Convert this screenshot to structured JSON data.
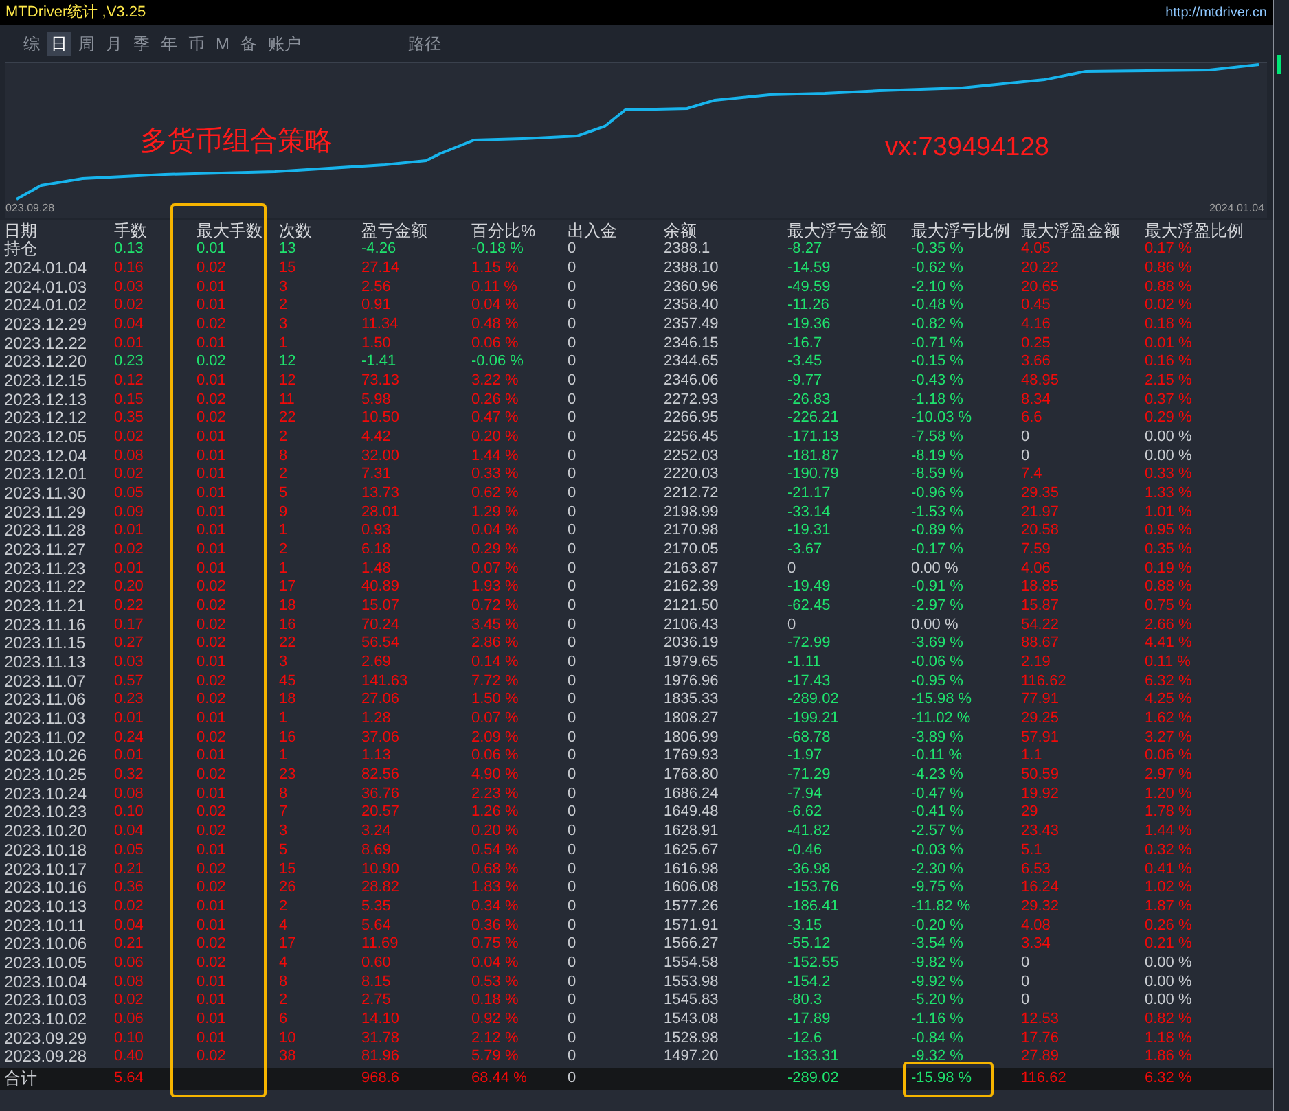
{
  "window": {
    "title": "MTDriver统计 ,V3.25",
    "link": "http://mtdriver.cn"
  },
  "tabs": [
    {
      "label": "综",
      "selected": false
    },
    {
      "label": "日",
      "selected": true
    },
    {
      "label": "周",
      "selected": false
    },
    {
      "label": "月",
      "selected": false
    },
    {
      "label": "季",
      "selected": false
    },
    {
      "label": "年",
      "selected": false
    },
    {
      "label": "币",
      "selected": false
    },
    {
      "label": "M",
      "selected": false
    },
    {
      "label": "备",
      "selected": false
    },
    {
      "label": "账户",
      "selected": false
    },
    {
      "label": "路径",
      "selected": false
    }
  ],
  "equity_chart": {
    "start_label": "023.09.28",
    "end_label": "2024.01.04",
    "caption": "多货币组合策略",
    "contact": "vx:739494128"
  },
  "table": {
    "columns": [
      "日期",
      "手数",
      "最大手数",
      "次数",
      "盈亏金额",
      "百分比%",
      "出入金",
      "余额",
      "最大浮亏金额",
      "最大浮亏比例",
      "最大浮盈金额",
      "最大浮盈比例"
    ],
    "rows": [
      {
        "loss": true,
        "no_float_loss": false,
        "no_float_profit": false,
        "cells": [
          "持仓",
          "0.13",
          "0.01",
          "13",
          "-4.26",
          "-0.18 %",
          "0",
          "2388.1",
          "-8.27",
          "-0.35 %",
          "4.05",
          "0.17 %"
        ]
      },
      {
        "loss": false,
        "no_float_loss": false,
        "no_float_profit": false,
        "cells": [
          "2024.01.04",
          "0.16",
          "0.02",
          "15",
          "27.14",
          "1.15 %",
          "0",
          "2388.10",
          "-14.59",
          "-0.62 %",
          "20.22",
          "0.86 %"
        ]
      },
      {
        "loss": false,
        "no_float_loss": false,
        "no_float_profit": false,
        "cells": [
          "2024.01.03",
          "0.03",
          "0.01",
          "3",
          "2.56",
          "0.11 %",
          "0",
          "2360.96",
          "-49.59",
          "-2.10 %",
          "20.65",
          "0.88 %"
        ]
      },
      {
        "loss": false,
        "no_float_loss": false,
        "no_float_profit": false,
        "cells": [
          "2024.01.02",
          "0.02",
          "0.01",
          "2",
          "0.91",
          "0.04 %",
          "0",
          "2358.40",
          "-11.26",
          "-0.48 %",
          "0.45",
          "0.02 %"
        ]
      },
      {
        "loss": false,
        "no_float_loss": false,
        "no_float_profit": false,
        "cells": [
          "2023.12.29",
          "0.04",
          "0.02",
          "3",
          "11.34",
          "0.48 %",
          "0",
          "2357.49",
          "-19.36",
          "-0.82 %",
          "4.16",
          "0.18 %"
        ]
      },
      {
        "loss": false,
        "no_float_loss": false,
        "no_float_profit": false,
        "cells": [
          "2023.12.22",
          "0.01",
          "0.01",
          "1",
          "1.50",
          "0.06 %",
          "0",
          "2346.15",
          "-16.7",
          "-0.71 %",
          "0.25",
          "0.01 %"
        ]
      },
      {
        "loss": true,
        "no_float_loss": false,
        "no_float_profit": false,
        "cells": [
          "2023.12.20",
          "0.23",
          "0.02",
          "12",
          "-1.41",
          "-0.06 %",
          "0",
          "2344.65",
          "-3.45",
          "-0.15 %",
          "3.66",
          "0.16 %"
        ]
      },
      {
        "loss": false,
        "no_float_loss": false,
        "no_float_profit": false,
        "cells": [
          "2023.12.15",
          "0.12",
          "0.01",
          "12",
          "73.13",
          "3.22 %",
          "0",
          "2346.06",
          "-9.77",
          "-0.43 %",
          "48.95",
          "2.15 %"
        ]
      },
      {
        "loss": false,
        "no_float_loss": false,
        "no_float_profit": false,
        "cells": [
          "2023.12.13",
          "0.15",
          "0.02",
          "11",
          "5.98",
          "0.26 %",
          "0",
          "2272.93",
          "-26.83",
          "-1.18 %",
          "8.34",
          "0.37 %"
        ]
      },
      {
        "loss": false,
        "no_float_loss": false,
        "no_float_profit": false,
        "cells": [
          "2023.12.12",
          "0.35",
          "0.02",
          "22",
          "10.50",
          "0.47 %",
          "0",
          "2266.95",
          "-226.21",
          "-10.03 %",
          "6.6",
          "0.29 %"
        ]
      },
      {
        "loss": false,
        "no_float_loss": false,
        "no_float_profit": true,
        "cells": [
          "2023.12.05",
          "0.02",
          "0.01",
          "2",
          "4.42",
          "0.20 %",
          "0",
          "2256.45",
          "-171.13",
          "-7.58 %",
          "0",
          "0.00 %"
        ]
      },
      {
        "loss": false,
        "no_float_loss": false,
        "no_float_profit": true,
        "cells": [
          "2023.12.04",
          "0.08",
          "0.01",
          "8",
          "32.00",
          "1.44 %",
          "0",
          "2252.03",
          "-181.87",
          "-8.19 %",
          "0",
          "0.00 %"
        ]
      },
      {
        "loss": false,
        "no_float_loss": false,
        "no_float_profit": false,
        "cells": [
          "2023.12.01",
          "0.02",
          "0.01",
          "2",
          "7.31",
          "0.33 %",
          "0",
          "2220.03",
          "-190.79",
          "-8.59 %",
          "7.4",
          "0.33 %"
        ]
      },
      {
        "loss": false,
        "no_float_loss": false,
        "no_float_profit": false,
        "cells": [
          "2023.11.30",
          "0.05",
          "0.01",
          "5",
          "13.73",
          "0.62 %",
          "0",
          "2212.72",
          "-21.17",
          "-0.96 %",
          "29.35",
          "1.33 %"
        ]
      },
      {
        "loss": false,
        "no_float_loss": false,
        "no_float_profit": false,
        "cells": [
          "2023.11.29",
          "0.09",
          "0.01",
          "9",
          "28.01",
          "1.29 %",
          "0",
          "2198.99",
          "-33.14",
          "-1.53 %",
          "21.97",
          "1.01 %"
        ]
      },
      {
        "loss": false,
        "no_float_loss": false,
        "no_float_profit": false,
        "cells": [
          "2023.11.28",
          "0.01",
          "0.01",
          "1",
          "0.93",
          "0.04 %",
          "0",
          "2170.98",
          "-19.31",
          "-0.89 %",
          "20.58",
          "0.95 %"
        ]
      },
      {
        "loss": false,
        "no_float_loss": false,
        "no_float_profit": false,
        "cells": [
          "2023.11.27",
          "0.02",
          "0.01",
          "2",
          "6.18",
          "0.29 %",
          "0",
          "2170.05",
          "-3.67",
          "-0.17 %",
          "7.59",
          "0.35 %"
        ]
      },
      {
        "loss": false,
        "no_float_loss": true,
        "no_float_profit": false,
        "cells": [
          "2023.11.23",
          "0.01",
          "0.01",
          "1",
          "1.48",
          "0.07 %",
          "0",
          "2163.87",
          "0",
          "0.00 %",
          "4.06",
          "0.19 %"
        ]
      },
      {
        "loss": false,
        "no_float_loss": false,
        "no_float_profit": false,
        "cells": [
          "2023.11.22",
          "0.20",
          "0.02",
          "17",
          "40.89",
          "1.93 %",
          "0",
          "2162.39",
          "-19.49",
          "-0.91 %",
          "18.85",
          "0.88 %"
        ]
      },
      {
        "loss": false,
        "no_float_loss": false,
        "no_float_profit": false,
        "cells": [
          "2023.11.21",
          "0.22",
          "0.02",
          "18",
          "15.07",
          "0.72 %",
          "0",
          "2121.50",
          "-62.45",
          "-2.97 %",
          "15.87",
          "0.75 %"
        ]
      },
      {
        "loss": false,
        "no_float_loss": true,
        "no_float_profit": false,
        "cells": [
          "2023.11.16",
          "0.17",
          "0.02",
          "16",
          "70.24",
          "3.45 %",
          "0",
          "2106.43",
          "0",
          "0.00 %",
          "54.22",
          "2.66 %"
        ]
      },
      {
        "loss": false,
        "no_float_loss": false,
        "no_float_profit": false,
        "cells": [
          "2023.11.15",
          "0.27",
          "0.02",
          "22",
          "56.54",
          "2.86 %",
          "0",
          "2036.19",
          "-72.99",
          "-3.69 %",
          "88.67",
          "4.41 %"
        ]
      },
      {
        "loss": false,
        "no_float_loss": false,
        "no_float_profit": false,
        "cells": [
          "2023.11.13",
          "0.03",
          "0.01",
          "3",
          "2.69",
          "0.14 %",
          "0",
          "1979.65",
          "-1.11",
          "-0.06 %",
          "2.19",
          "0.11 %"
        ]
      },
      {
        "loss": false,
        "no_float_loss": false,
        "no_float_profit": false,
        "cells": [
          "2023.11.07",
          "0.57",
          "0.02",
          "45",
          "141.63",
          "7.72 %",
          "0",
          "1976.96",
          "-17.43",
          "-0.95 %",
          "116.62",
          "6.32 %"
        ]
      },
      {
        "loss": false,
        "no_float_loss": false,
        "no_float_profit": false,
        "cells": [
          "2023.11.06",
          "0.23",
          "0.02",
          "18",
          "27.06",
          "1.50 %",
          "0",
          "1835.33",
          "-289.02",
          "-15.98 %",
          "77.91",
          "4.25 %"
        ]
      },
      {
        "loss": false,
        "no_float_loss": false,
        "no_float_profit": false,
        "cells": [
          "2023.11.03",
          "0.01",
          "0.01",
          "1",
          "1.28",
          "0.07 %",
          "0",
          "1808.27",
          "-199.21",
          "-11.02 %",
          "29.25",
          "1.62 %"
        ]
      },
      {
        "loss": false,
        "no_float_loss": false,
        "no_float_profit": false,
        "cells": [
          "2023.11.02",
          "0.24",
          "0.02",
          "16",
          "37.06",
          "2.09 %",
          "0",
          "1806.99",
          "-68.78",
          "-3.89 %",
          "57.91",
          "3.27 %"
        ]
      },
      {
        "loss": false,
        "no_float_loss": false,
        "no_float_profit": false,
        "cells": [
          "2023.10.26",
          "0.01",
          "0.01",
          "1",
          "1.13",
          "0.06 %",
          "0",
          "1769.93",
          "-1.97",
          "-0.11 %",
          "1.1",
          "0.06 %"
        ]
      },
      {
        "loss": false,
        "no_float_loss": false,
        "no_float_profit": false,
        "cells": [
          "2023.10.25",
          "0.32",
          "0.02",
          "23",
          "82.56",
          "4.90 %",
          "0",
          "1768.80",
          "-71.29",
          "-4.23 %",
          "50.59",
          "2.97 %"
        ]
      },
      {
        "loss": false,
        "no_float_loss": false,
        "no_float_profit": false,
        "cells": [
          "2023.10.24",
          "0.08",
          "0.01",
          "8",
          "36.76",
          "2.23 %",
          "0",
          "1686.24",
          "-7.94",
          "-0.47 %",
          "19.92",
          "1.20 %"
        ]
      },
      {
        "loss": false,
        "no_float_loss": false,
        "no_float_profit": false,
        "cells": [
          "2023.10.23",
          "0.10",
          "0.02",
          "7",
          "20.57",
          "1.26 %",
          "0",
          "1649.48",
          "-6.62",
          "-0.41 %",
          "29",
          "1.78 %"
        ]
      },
      {
        "loss": false,
        "no_float_loss": false,
        "no_float_profit": false,
        "cells": [
          "2023.10.20",
          "0.04",
          "0.02",
          "3",
          "3.24",
          "0.20 %",
          "0",
          "1628.91",
          "-41.82",
          "-2.57 %",
          "23.43",
          "1.44 %"
        ]
      },
      {
        "loss": false,
        "no_float_loss": false,
        "no_float_profit": false,
        "cells": [
          "2023.10.18",
          "0.05",
          "0.01",
          "5",
          "8.69",
          "0.54 %",
          "0",
          "1625.67",
          "-0.46",
          "-0.03 %",
          "5.1",
          "0.32 %"
        ]
      },
      {
        "loss": false,
        "no_float_loss": false,
        "no_float_profit": false,
        "cells": [
          "2023.10.17",
          "0.21",
          "0.02",
          "15",
          "10.90",
          "0.68 %",
          "0",
          "1616.98",
          "-36.98",
          "-2.30 %",
          "6.53",
          "0.41 %"
        ]
      },
      {
        "loss": false,
        "no_float_loss": false,
        "no_float_profit": false,
        "cells": [
          "2023.10.16",
          "0.36",
          "0.02",
          "26",
          "28.82",
          "1.83 %",
          "0",
          "1606.08",
          "-153.76",
          "-9.75 %",
          "16.24",
          "1.02 %"
        ]
      },
      {
        "loss": false,
        "no_float_loss": false,
        "no_float_profit": false,
        "cells": [
          "2023.10.13",
          "0.02",
          "0.01",
          "2",
          "5.35",
          "0.34 %",
          "0",
          "1577.26",
          "-186.41",
          "-11.82 %",
          "29.32",
          "1.87 %"
        ]
      },
      {
        "loss": false,
        "no_float_loss": false,
        "no_float_profit": false,
        "cells": [
          "2023.10.11",
          "0.04",
          "0.01",
          "4",
          "5.64",
          "0.36 %",
          "0",
          "1571.91",
          "-3.15",
          "-0.20 %",
          "4.08",
          "0.26 %"
        ]
      },
      {
        "loss": false,
        "no_float_loss": false,
        "no_float_profit": false,
        "cells": [
          "2023.10.06",
          "0.21",
          "0.02",
          "17",
          "11.69",
          "0.75 %",
          "0",
          "1566.27",
          "-55.12",
          "-3.54 %",
          "3.34",
          "0.21 %"
        ]
      },
      {
        "loss": false,
        "no_float_loss": false,
        "no_float_profit": true,
        "cells": [
          "2023.10.05",
          "0.06",
          "0.02",
          "4",
          "0.60",
          "0.04 %",
          "0",
          "1554.58",
          "-152.55",
          "-9.82 %",
          "0",
          "0.00 %"
        ]
      },
      {
        "loss": false,
        "no_float_loss": false,
        "no_float_profit": true,
        "cells": [
          "2023.10.04",
          "0.08",
          "0.01",
          "8",
          "8.15",
          "0.53 %",
          "0",
          "1553.98",
          "-154.2",
          "-9.92 %",
          "0",
          "0.00 %"
        ]
      },
      {
        "loss": false,
        "no_float_loss": false,
        "no_float_profit": true,
        "cells": [
          "2023.10.03",
          "0.02",
          "0.01",
          "2",
          "2.75",
          "0.18 %",
          "0",
          "1545.83",
          "-80.3",
          "-5.20 %",
          "0",
          "0.00 %"
        ]
      },
      {
        "loss": false,
        "no_float_loss": false,
        "no_float_profit": false,
        "cells": [
          "2023.10.02",
          "0.06",
          "0.01",
          "6",
          "14.10",
          "0.92 %",
          "0",
          "1543.08",
          "-17.89",
          "-1.16 %",
          "12.53",
          "0.82 %"
        ]
      },
      {
        "loss": false,
        "no_float_loss": false,
        "no_float_profit": false,
        "cells": [
          "2023.09.29",
          "0.10",
          "0.01",
          "10",
          "31.78",
          "2.12 %",
          "0",
          "1528.98",
          "-12.6",
          "-0.84 %",
          "17.76",
          "1.18 %"
        ]
      },
      {
        "loss": false,
        "no_float_loss": false,
        "no_float_profit": false,
        "cells": [
          "2023.09.28",
          "0.40",
          "0.02",
          "38",
          "81.96",
          "5.79 %",
          "0",
          "1497.20",
          "-133.31",
          "-9.32 %",
          "27.89",
          "1.86 %"
        ]
      }
    ],
    "total": {
      "loss": false,
      "no_float_loss": false,
      "no_float_profit": false,
      "cells": [
        "合计",
        "5.64",
        null,
        null,
        "968.6",
        "68.44 %",
        "0",
        null,
        "-289.02",
        "-15.98 %",
        "116.62",
        "6.32 %"
      ]
    }
  }
}
